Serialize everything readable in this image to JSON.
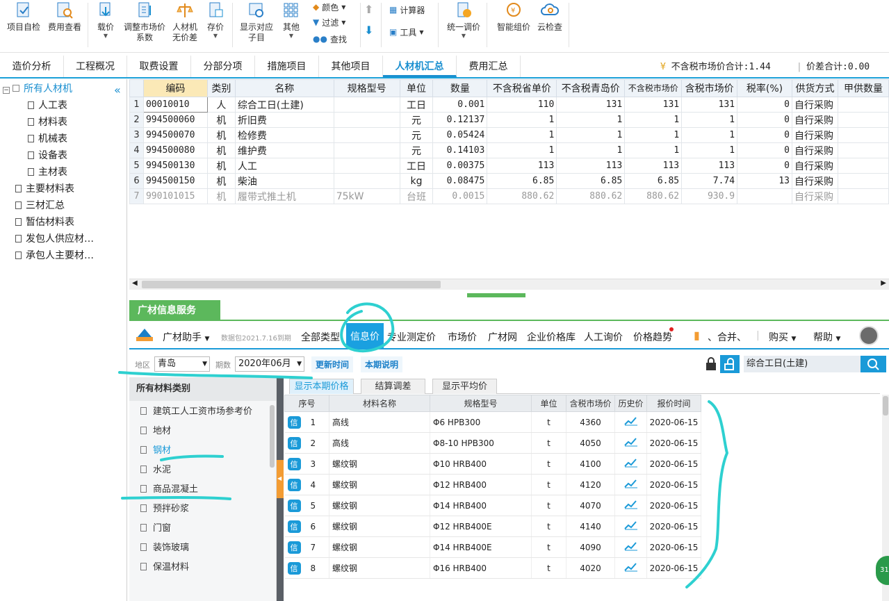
{
  "toolbar": {
    "buttons": [
      {
        "label": "项目自检",
        "icon": "project-check-icon"
      },
      {
        "label": "费用查看",
        "icon": "cost-view-icon"
      },
      {
        "label": "载价",
        "icon": "load-price-icon"
      },
      {
        "label": "调整市场价系数",
        "icon": "adjust-coef-icon"
      },
      {
        "label": "人材机无价差",
        "icon": "scale-icon"
      },
      {
        "label": "存价",
        "icon": "save-price-icon"
      },
      {
        "label": "显示对应子目",
        "icon": "show-sub-icon"
      },
      {
        "label": "其他",
        "icon": "grid-icon"
      },
      {
        "label": "统一调价",
        "icon": "unify-price-icon"
      },
      {
        "label": "智能组价",
        "icon": "smart-price-icon"
      },
      {
        "label": "云检查",
        "icon": "cloud-check-icon"
      }
    ],
    "small": {
      "color": "颜色",
      "filter": "过滤",
      "find": "查找",
      "calculator": "计算器",
      "tools": "工具"
    }
  },
  "tabs": [
    "造价分析",
    "工程概况",
    "取费设置",
    "分部分项",
    "措施项目",
    "其他项目",
    "人材机汇总",
    "费用汇总"
  ],
  "active_tab": "人材机汇总",
  "summary": {
    "market_total": "不含税市场价合计:1.44",
    "diff_total": "价差合计:0.00"
  },
  "tree": [
    "所有人材机",
    "人工表",
    "材料表",
    "机械表",
    "设备表",
    "主材表",
    "主要材料表",
    "三材汇总",
    "暂估材料表",
    "发包人供应材…",
    "承包人主要材…"
  ],
  "grid": {
    "headers": [
      "编码",
      "类别",
      "名称",
      "规格型号",
      "单位",
      "数量",
      "不含税省单价",
      "不含税青岛价",
      "不含税市场价",
      "含税市场价",
      "税率(%)",
      "供货方式",
      "甲供数量"
    ],
    "rows": [
      {
        "n": "1",
        "code": "00010010",
        "type": "人",
        "name": "综合工日(土建)",
        "spec": "",
        "unit": "工日",
        "qty": "0.001",
        "p1": "110",
        "p2": "131",
        "p3": "131",
        "p4": "131",
        "tax": "0",
        "supply": "自行采购"
      },
      {
        "n": "2",
        "code": "994500060",
        "type": "机",
        "name": "折旧费",
        "spec": "",
        "unit": "元",
        "qty": "0.12137",
        "p1": "1",
        "p2": "1",
        "p3": "1",
        "p4": "1",
        "tax": "0",
        "supply": "自行采购"
      },
      {
        "n": "3",
        "code": "994500070",
        "type": "机",
        "name": "检修费",
        "spec": "",
        "unit": "元",
        "qty": "0.05424",
        "p1": "1",
        "p2": "1",
        "p3": "1",
        "p4": "1",
        "tax": "0",
        "supply": "自行采购"
      },
      {
        "n": "4",
        "code": "994500080",
        "type": "机",
        "name": "维护费",
        "spec": "",
        "unit": "元",
        "qty": "0.14103",
        "p1": "1",
        "p2": "1",
        "p3": "1",
        "p4": "1",
        "tax": "0",
        "supply": "自行采购"
      },
      {
        "n": "5",
        "code": "994500130",
        "type": "机",
        "name": "人工",
        "spec": "",
        "unit": "工日",
        "qty": "0.00375",
        "p1": "113",
        "p2": "113",
        "p3": "113",
        "p4": "113",
        "tax": "0",
        "supply": "自行采购"
      },
      {
        "n": "6",
        "code": "994500150",
        "type": "机",
        "name": "柴油",
        "spec": "",
        "unit": "kg",
        "qty": "0.08475",
        "p1": "6.85",
        "p2": "6.85",
        "p3": "6.85",
        "p4": "7.74",
        "tax": "13",
        "supply": "自行采购"
      },
      {
        "n": "7",
        "code": "990101015",
        "type": "机",
        "name": "履带式推土机",
        "spec": "75kW",
        "unit": "台班",
        "qty": "0.0015",
        "p1": "880.62",
        "p2": "880.62",
        "p3": "880.62",
        "p4": "930.9",
        "tax": "",
        "supply": "自行采购"
      }
    ]
  },
  "guangcai": {
    "header": "广材信息服务",
    "assistant": "广材助手",
    "data_pack": "数据包2021.7.16到期",
    "nav": [
      "全部类型",
      "信息价",
      "专业测定价",
      "市场价",
      "广材网",
      "企业价格库",
      "人工询价",
      "价格趋势"
    ],
    "nav_right": {
      "merge": "、合并、",
      "buy": "购买",
      "help": "帮助"
    },
    "region_label": "地区",
    "region": "青岛",
    "period_label": "期数",
    "period": "2020年06月",
    "update_time": "更新时间",
    "period_note": "本期说明",
    "search_value": "综合工日(土建)",
    "categories_head": "所有材料类别",
    "categories": [
      "建筑工人工资市场参考价",
      "地材",
      "钢材",
      "水泥",
      "商品混凝土",
      "预拌砂浆",
      "门窗",
      "装饰玻璃",
      "保温材料"
    ],
    "subtabs": [
      "显示本期价格",
      "结算调差",
      "显示平均价"
    ],
    "table_headers": [
      "序号",
      "材料名称",
      "规格型号",
      "单位",
      "含税市场价",
      "历史价",
      "报价时间"
    ],
    "tag": "信",
    "rows": [
      {
        "n": "1",
        "name": "高线",
        "spec": "Φ6  HPB300",
        "unit": "t",
        "price": "4360",
        "date": "2020-06-15"
      },
      {
        "n": "2",
        "name": "高线",
        "spec": "Φ8-10  HPB300",
        "unit": "t",
        "price": "4050",
        "date": "2020-06-15"
      },
      {
        "n": "3",
        "name": "螺纹钢",
        "spec": "Φ10 HRB400",
        "unit": "t",
        "price": "4100",
        "date": "2020-06-15"
      },
      {
        "n": "4",
        "name": "螺纹钢",
        "spec": "Φ12 HRB400",
        "unit": "t",
        "price": "4120",
        "date": "2020-06-15"
      },
      {
        "n": "5",
        "name": "螺纹钢",
        "spec": "Φ14 HRB400",
        "unit": "t",
        "price": "4070",
        "date": "2020-06-15"
      },
      {
        "n": "6",
        "name": "螺纹钢",
        "spec": "Φ12 HRB400E",
        "unit": "t",
        "price": "4140",
        "date": "2020-06-15"
      },
      {
        "n": "7",
        "name": "螺纹钢",
        "spec": "Φ14 HRB400E",
        "unit": "t",
        "price": "4090",
        "date": "2020-06-15"
      },
      {
        "n": "8",
        "name": "螺纹钢",
        "spec": "Φ16 HRB400",
        "unit": "t",
        "price": "4020",
        "date": "2020-06-15"
      }
    ]
  },
  "colors": {
    "accent": "#1a9ad8",
    "green": "#5cb85c",
    "annotation": "#2ed0d0"
  }
}
